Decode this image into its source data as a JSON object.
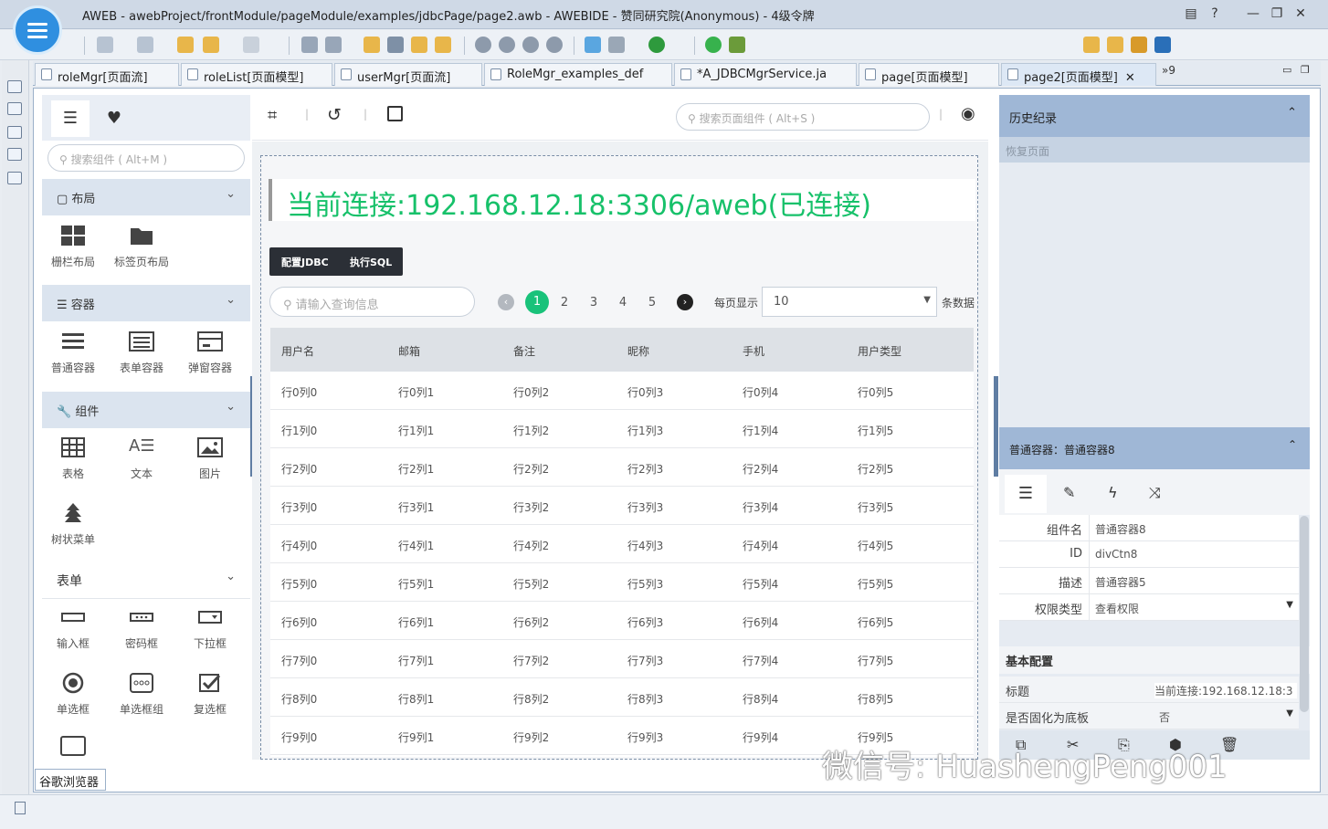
{
  "window": {
    "title": "AWEB - awebProject/frontModule/pageModule/examples/jdbcPage/page2.awb - AWEBIDE - 赞同研究院(Anonymous) - 4级令牌"
  },
  "editor_tabs": [
    "roleMgr[页面流]",
    "roleList[页面模型]",
    "userMgr[页面流]",
    "RoleMgr_examples_def",
    "*A_JDBCMgrService.ja",
    "page[页面模型]",
    "page2[页面模型]"
  ],
  "tab_overflow": "»9",
  "palette": {
    "search_placeholder": "搜索组件 ( Alt+M )",
    "sections": {
      "layout": {
        "label": "布局",
        "items": [
          "栅栏布局",
          "标签页布局"
        ]
      },
      "container": {
        "label": "容器",
        "items": [
          "普通容器",
          "表单容器",
          "弹窗容器"
        ]
      },
      "component": {
        "label": "组件",
        "items": [
          "表格",
          "文本",
          "图片",
          "树状菜单"
        ]
      },
      "form": {
        "label": "表单",
        "items": [
          "输入框",
          "密码框",
          "下拉框",
          "单选框",
          "单选框组",
          "复选框"
        ]
      }
    }
  },
  "canvas": {
    "search_placeholder": "搜索页面组件 ( Alt+S )",
    "connection_title": "当前连接:192.168.12.18:3306/aweb(已连接)",
    "buttons": {
      "config_jdbc": "配置JDBC",
      "exec_sql": "执行SQL"
    },
    "query_placeholder": "请输入查询信息",
    "pagination": {
      "current": "1",
      "pages": [
        "2",
        "3",
        "4",
        "5"
      ],
      "per_page_label": "每页显示",
      "per_page_value": "10",
      "suffix": "条数据"
    },
    "table": {
      "headers": [
        "用户名",
        "邮箱",
        "备注",
        "昵称",
        "手机",
        "用户类型"
      ],
      "rows": [
        [
          "行0列0",
          "行0列1",
          "行0列2",
          "行0列3",
          "行0列4",
          "行0列5"
        ],
        [
          "行1列0",
          "行1列1",
          "行1列2",
          "行1列3",
          "行1列4",
          "行1列5"
        ],
        [
          "行2列0",
          "行2列1",
          "行2列2",
          "行2列3",
          "行2列4",
          "行2列5"
        ],
        [
          "行3列0",
          "行3列1",
          "行3列2",
          "行3列3",
          "行3列4",
          "行3列5"
        ],
        [
          "行4列0",
          "行4列1",
          "行4列2",
          "行4列3",
          "行4列4",
          "行4列5"
        ],
        [
          "行5列0",
          "行5列1",
          "行5列2",
          "行5列3",
          "行5列4",
          "行5列5"
        ],
        [
          "行6列0",
          "行6列1",
          "行6列2",
          "行6列3",
          "行6列4",
          "行6列5"
        ],
        [
          "行7列0",
          "行7列1",
          "行7列2",
          "行7列3",
          "行7列4",
          "行7列5"
        ],
        [
          "行8列0",
          "行8列1",
          "行8列2",
          "行8列3",
          "行8列4",
          "行8列5"
        ],
        [
          "行9列0",
          "行9列1",
          "行9列2",
          "行9列3",
          "行9列4",
          "行9列5"
        ]
      ]
    }
  },
  "history": {
    "title": "历史纪录",
    "item": "恢复页面"
  },
  "properties": {
    "title": "普通容器：普通容器8",
    "rows": [
      {
        "label": "组件名",
        "value": "普通容器8"
      },
      {
        "label": "ID",
        "value": "divCtn8"
      },
      {
        "label": "描述",
        "value": "普通容器5"
      },
      {
        "label": "权限类型",
        "value": "查看权限"
      }
    ],
    "basic_title": "基本配置",
    "basic_rows": [
      {
        "label": "标题",
        "value": "当前连接:192.168.12.18:3"
      },
      {
        "label": "是否固化为底板",
        "value": "否"
      }
    ]
  },
  "bottom_tab": "谷歌浏览器",
  "watermark": "微信号: HuashengPeng001",
  "colors": {
    "accent_green": "#19c27a",
    "panel_blue": "#9fb7d6",
    "title_green": "#17c16a"
  }
}
